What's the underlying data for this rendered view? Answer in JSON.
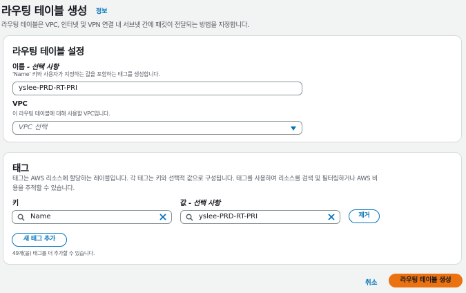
{
  "header": {
    "title": "라우팅 테이블 생성",
    "info_link": "정보",
    "description": "라우팅 테이블은 VPC, 인터넷 및 VPN 연결 내 서브넷 간에 패킷이 전달되는 방법을 지정합니다."
  },
  "settings": {
    "title": "라우팅 테이블 설정",
    "name_field": {
      "label": "이름",
      "optional": " - 선택 사항",
      "description": "'Name' 키와 사용자가 지정하는 값을 포함하는 태그를 생성합니다.",
      "value": "yslee-PRD-RT-PRI"
    },
    "vpc_field": {
      "label": "VPC",
      "description": "이 라우팅 테이블에 대해 사용할 VPC입니다.",
      "placeholder": "VPC 선택"
    }
  },
  "tags": {
    "title": "태그",
    "description_line1": "태그는 AWS 리소스에 할당하는 레이블입니다. 각 태그는 키와 선택적 값으로 구성됩니다. 태그를 사용하여 리소스를 검색 및 필터링하거나 AWS 비",
    "description_line2": "용을 추적할 수 있습니다.",
    "key_label": "키",
    "value_label": "값",
    "value_optional": " - 선택 사항",
    "rows": [
      {
        "key": "Name",
        "value": "yslee-PRD-RT-PRI",
        "remove_label": "제거"
      }
    ],
    "add_button": "새 태그 추가",
    "remaining_text": "49개(을) 태그를 더 추가할 수 있습니다."
  },
  "footer": {
    "cancel_label": "취소",
    "create_label": "라우팅 테이블 생성"
  },
  "colors": {
    "accent": "#0073bb",
    "primary_button": "#ec7211",
    "background": "#f2f3f3"
  }
}
